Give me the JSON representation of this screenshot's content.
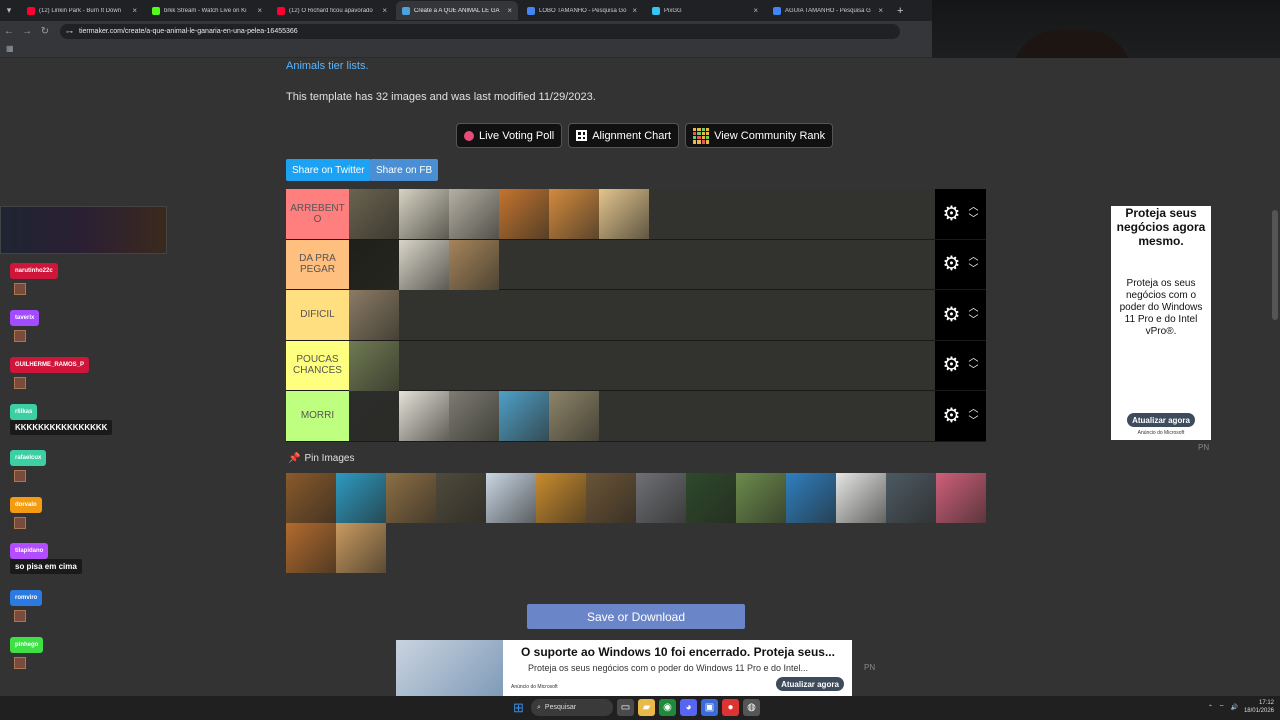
{
  "browser": {
    "tabs": [
      {
        "title": "(12) Linkin Park - Burn It Down",
        "color": "#ff0033"
      },
      {
        "title": "brkk Stream - Watch Live on Ki",
        "color": "#53fc18"
      },
      {
        "title": "(12) O Richard ficou apavorado",
        "color": "#ff0033"
      },
      {
        "title": "Create a A QUE ANIMAL LE GA",
        "color": "#4aa3df",
        "active": true
      },
      {
        "title": "LOBO TAMANHO - Pesquisa Go",
        "color": "#4285f4"
      },
      {
        "title": "PixGG",
        "color": "#36c5f0"
      },
      {
        "title": "AGUIA TAMANHO - Pesquisa G",
        "color": "#4285f4"
      }
    ],
    "url": "tiermaker.com/create/a-que-animal-le-ganaria-en-una-pelea-16455366"
  },
  "page": {
    "link": "Animals tier lists.",
    "info": "This template has 32 images and was last modified 11/29/2023.",
    "buttons": {
      "live_poll": "Live Voting Poll",
      "alignment": "Alignment Chart",
      "community": "View Community Rank"
    },
    "share_twitter": "Share on Twitter",
    "share_fb": "Share on FB",
    "pin_label": "Pin Images",
    "save": "Save or Download",
    "tiers": [
      {
        "label": "ARREBENT O",
        "color": "#ff7f7f",
        "images": [
          "#6b6350",
          "#d6d2c3",
          "#b5b0a5",
          "#c4742e",
          "#d48a3d",
          "#e3c48e"
        ]
      },
      {
        "label": "DA PRA PEGAR",
        "color": "#ffbf7f",
        "images": [
          "#1e1e1a",
          "#d8d4c8",
          "#a6845a"
        ]
      },
      {
        "label": "DIFICIL",
        "color": "#ffdf7f",
        "images": [
          "#8b7b64"
        ]
      },
      {
        "label": "POUCAS CHANCES",
        "color": "#ffff7f",
        "images": [
          "#6f7a52"
        ]
      },
      {
        "label": "MORRI",
        "color": "#bfff7f",
        "images": [
          "#2c2c2c",
          "#e4e1d8",
          "#7d7b72",
          "#4ea0c9",
          "#8e8468"
        ]
      }
    ],
    "pool_images": [
      "#8a5a2b",
      "#2d9ac2",
      "#8d6f45",
      "#4f4a3c",
      "#c9d6e4",
      "#c98b2e",
      "#6b5436",
      "#6f7076",
      "#2e4a2b",
      "#6c8b4c",
      "#2f7fc0",
      "#e5e5e5",
      "#4d5a63",
      "#cf5f7a",
      "#b36b2d",
      "#c99a60"
    ]
  },
  "ads": {
    "right_title": "Proteja seus negócios agora mesmo.",
    "right_text": "Proteja os seus negócios com o poder do Windows 11 Pro e do Intel vPro®.",
    "right_button": "Atualizar agora",
    "right_brand": "Anúncio do Microsoft",
    "bottom_title": "O suporte ao Windows 10 foi encerrado. Proteja seus...",
    "bottom_text": "Proteja os seus negócios com o poder do Windows 11 Pro e do Intel...",
    "bottom_button": "Atualizar agora",
    "bottom_brand": "Anúncio do Microsoft",
    "pn": "PN"
  },
  "chat": [
    {
      "user": "narutinho22c",
      "color": "#d0153a"
    },
    {
      "user": "taverix",
      "color": "#a24bff"
    },
    {
      "user": "GUILHERME_RAMOS_P",
      "color": "#d0153a"
    },
    {
      "user": "rlilkas",
      "color": "#3ccfa4",
      "message": "KKKKKKKKKKKKKKKK"
    },
    {
      "user": "rafaelcux",
      "color": "#3ccfa4"
    },
    {
      "user": "dorvalo",
      "color": "#f39c12"
    },
    {
      "user": "tilapidano",
      "color": "#b44dff",
      "message": "so pisa em cima"
    },
    {
      "user": "romviro",
      "color": "#2a7ae2"
    },
    {
      "user": "pinhego",
      "color": "#3ee046"
    }
  ],
  "taskbar": {
    "search": "Pesquisar",
    "time": "17:12",
    "date": "18/01/2026"
  }
}
